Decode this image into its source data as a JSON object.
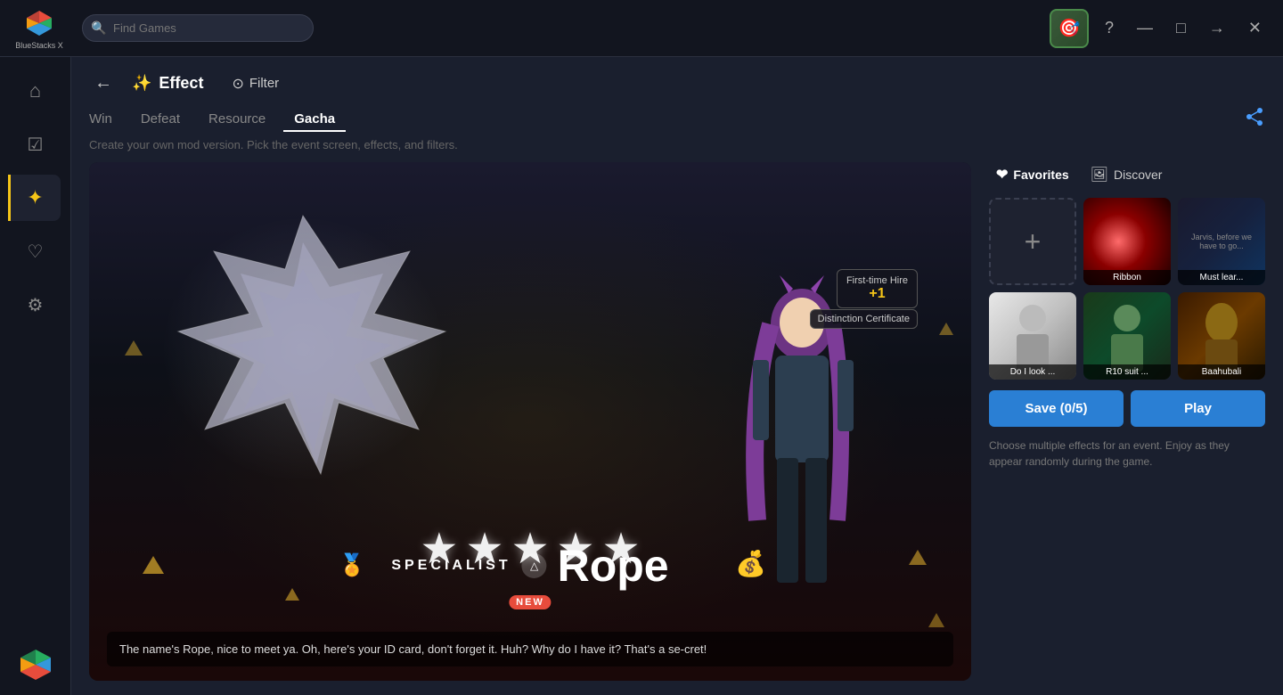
{
  "app": {
    "name": "BlueStacks X",
    "logo_text": "BlueStacks X"
  },
  "topbar": {
    "search_placeholder": "Find Games",
    "game_icon": "🎮",
    "help_btn": "?",
    "minimize_btn": "—",
    "maximize_btn": "□",
    "arrow_btn": "→",
    "close_btn": "✕"
  },
  "sidebar": {
    "items": [
      {
        "id": "home",
        "icon": "⌂",
        "label": "Home"
      },
      {
        "id": "store",
        "icon": "☑",
        "label": "Store"
      },
      {
        "id": "mods",
        "icon": "✦",
        "label": "Mods",
        "active": true
      },
      {
        "id": "favorites",
        "icon": "♡",
        "label": "Favorites"
      },
      {
        "id": "settings",
        "icon": "⚙",
        "label": "Settings"
      }
    ]
  },
  "page": {
    "back_label": "←",
    "heading": "Effect",
    "filter_label": "Filter",
    "subtitle": "Create your own mod version. Pick the event screen, effects, and filters.",
    "tabs": [
      {
        "id": "win",
        "label": "Win"
      },
      {
        "id": "defeat",
        "label": "Defeat",
        "active": false
      },
      {
        "id": "resource",
        "label": "Resource"
      },
      {
        "id": "gacha",
        "label": "Gacha",
        "active": true
      }
    ]
  },
  "preview": {
    "stars": [
      "★",
      "★",
      "★",
      "★",
      "★"
    ],
    "specialist_label": "SPECIALIST",
    "char_name": "Rope",
    "new_badge": "NEW",
    "subtitle_text": "The name's Rope, nice to meet ya. Oh, here's your ID card, don't forget it. Huh? Why do I have it? That's a se-cret!",
    "hire_badge_title": "First-time Hire",
    "hire_badge_value": "+1",
    "cert_label": "Distinction Certificate"
  },
  "right_panel": {
    "tab_favorites": "Favorites",
    "tab_discover": "Discover",
    "thumbnails": [
      {
        "id": "add",
        "type": "add",
        "label": ""
      },
      {
        "id": "ribbon",
        "type": "ribbon",
        "label": "Ribbon"
      },
      {
        "id": "mustlear",
        "type": "mustlear",
        "label": "Must lear..."
      },
      {
        "id": "dolook",
        "type": "dolook",
        "label": "Do I look ..."
      },
      {
        "id": "r10suit",
        "type": "r10",
        "label": "R10 suit ..."
      },
      {
        "id": "baahu",
        "type": "baahu",
        "label": "Baahubali"
      }
    ],
    "save_btn": "Save (0/5)",
    "play_btn": "Play",
    "note": "Choose multiple effects for an event. Enjoy as they appear randomly during the game."
  }
}
